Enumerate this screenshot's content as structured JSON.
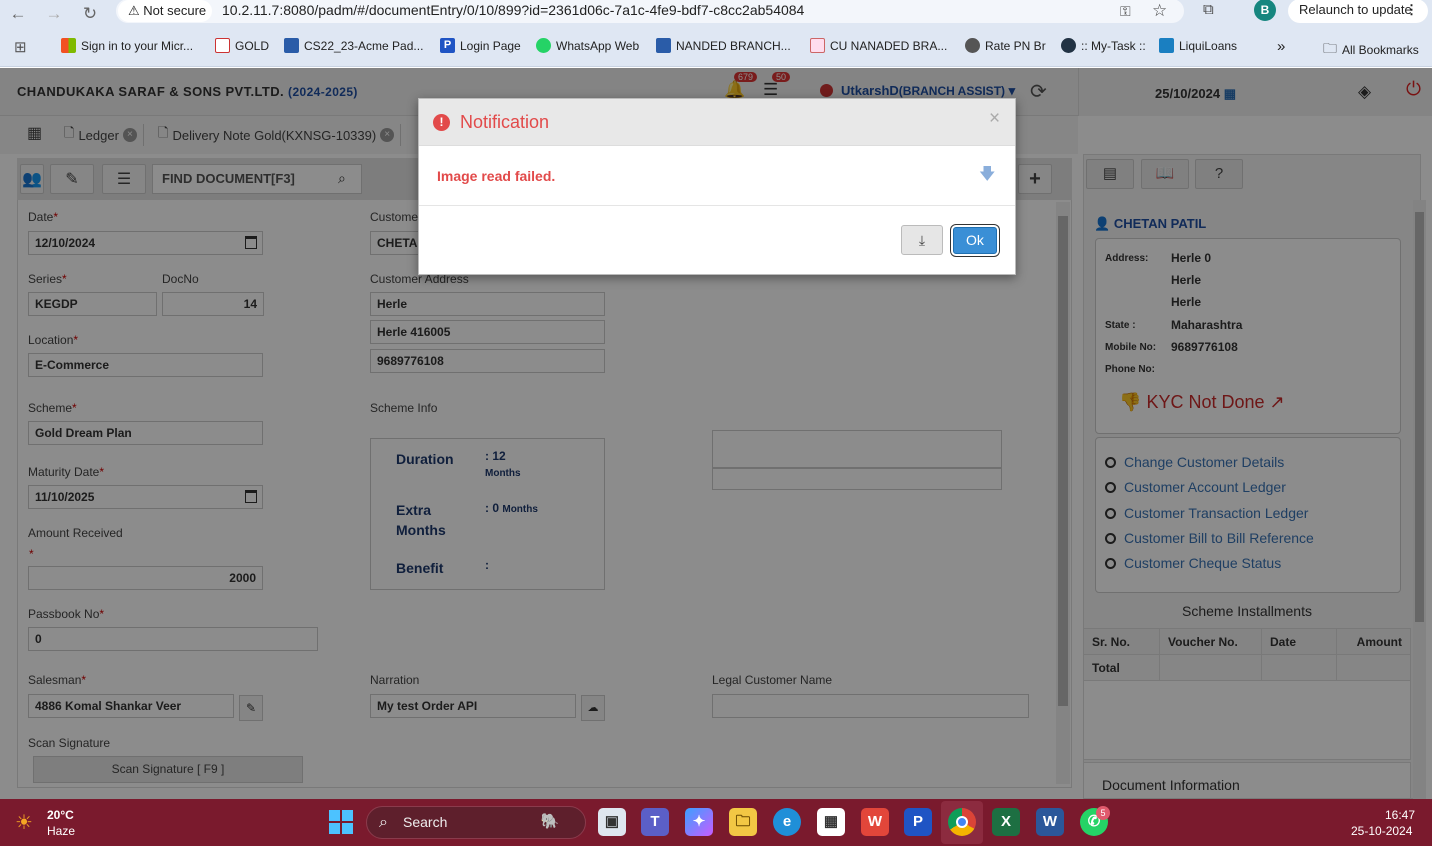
{
  "browser": {
    "not_secure": "Not secure",
    "url": "10.2.11.7:8080/padm/#/documentEntry/0/10/899?id=2361d06c-7a1c-4fe9-bdf7-c8cc2ab54084",
    "profile_initial": "B",
    "relaunch": "Relaunch to update",
    "bookmarks": [
      "Sign in to your Micr...",
      "GOLD",
      "CS22_23-Acme Pad...",
      "Login Page",
      "WhatsApp Web",
      "NANDED BRANCH...",
      "CU NANADED BRA...",
      "Rate PN Br",
      ":: My-Task ::",
      "LiquiLoans"
    ],
    "all_bookmarks": "All Bookmarks",
    "more": "»"
  },
  "header": {
    "company": "CHANDUKAKA SARAF & SONS PVT.LTD.",
    "year": "(2024-2025)",
    "bell_count": "679",
    "msg_count": "50",
    "user": "UtkarshD",
    "role": "(BRANCH ASSIST)",
    "date": "25/10/2024"
  },
  "tabs": [
    {
      "label": "Ledger"
    },
    {
      "label": "Delivery Note Gold(KXNSG-10339)"
    }
  ],
  "toolbar": {
    "find": "FIND DOCUMENT[F3]"
  },
  "form": {
    "date_label": "Date",
    "date": "12/10/2024",
    "series_label": "Series",
    "series": "KEGDP",
    "docno_label": "DocNo",
    "docno": "14",
    "location_label": "Location",
    "location": "E-Commerce",
    "scheme_label": "Scheme",
    "scheme": "Gold Dream Plan",
    "maturity_label": "Maturity Date",
    "maturity": "11/10/2025",
    "amount_label": "Amount Received",
    "amount": "2000",
    "passbook_label": "Passbook No",
    "passbook": "0",
    "salesman_label": "Salesman",
    "salesman": "4886 Komal Shankar Veer",
    "signature_label": "Scan Signature",
    "signature_btn": "Scan Signature [ F9 ]",
    "customer_label": "Custome",
    "customer": "CHETA",
    "address_label": "Customer Address",
    "addr1": "Herle",
    "addr2": "Herle 416005",
    "addr3": "9689776108",
    "scheme_info_label": "Scheme Info",
    "duration_key": "Duration",
    "duration_val": ": 12",
    "duration_unit": "Months",
    "extra_key_1": "Extra",
    "extra_key_2": "Months",
    "extra_val": ": 0",
    "extra_unit": "Months",
    "benefit_key": "Benefit",
    "benefit_val": ":",
    "narration_label": "Narration",
    "narration": "My test Order API",
    "legal_label": "Legal Customer Name",
    "legal": ""
  },
  "customer_panel": {
    "name": "CHETAN PATIL",
    "address_key": "Address:",
    "address": [
      "Herle 0",
      "Herle",
      "Herle"
    ],
    "state_key": "State :",
    "state": "Maharashtra",
    "mobile_key": "Mobile No:",
    "mobile": "9689776108",
    "phone_key": "Phone No:",
    "kyc": "KYC Not Done",
    "links": [
      "Change Customer Details",
      "Customer Account Ledger",
      "Customer Transaction Ledger",
      "Customer Bill to Bill Reference",
      "Customer Cheque Status"
    ],
    "installments_title": "Scheme Installments",
    "columns": [
      "Sr. No.",
      "Voucher No.",
      "Date",
      "Amount"
    ],
    "total": "Total",
    "doc_info": "Document Information"
  },
  "modal": {
    "title": "Notification",
    "message": "Image read failed.",
    "close": "×",
    "ok": "Ok"
  },
  "taskbar": {
    "temp": "20°C",
    "weather": "Haze",
    "search": "Search",
    "whatsapp_badge": "5",
    "time": "16:47",
    "date": "25-10-2024"
  }
}
